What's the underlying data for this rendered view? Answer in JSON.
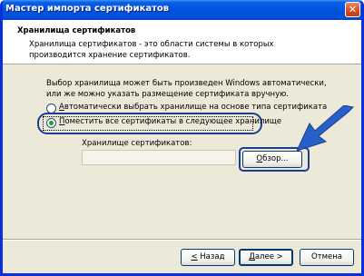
{
  "window": {
    "title": "Мастер импорта сертификатов",
    "close_symbol": "✕"
  },
  "header": {
    "title": "Хранилища сертификатов",
    "description": "Хранилища сертификатов - это области системы в которых производится хранение сертификатов."
  },
  "body": {
    "intro": "Выбор хранилища может быть произведен Windows автоматически, или же можно указать размещение сертификата вручную.",
    "radio_auto": "Автоматически выбрать хранилище на основе типа сертификата",
    "radio_manual": "Поместить все сертификаты в следующее хранилище",
    "store_label": "Хранилище сертификатов:",
    "store_value": "",
    "browse_button": "Обзор..."
  },
  "footer": {
    "back_button": "< Назад",
    "next_button": "Далее >",
    "cancel_button": "Отмена"
  },
  "colors": {
    "titlebar": "#0053e1",
    "highlight": "#1b3f8f",
    "arrow": "#2760c8"
  },
  "icons": {
    "close": "close-icon",
    "annotation_arrow": "arrow-icon"
  },
  "state": {
    "selected_option": "radio_manual"
  }
}
